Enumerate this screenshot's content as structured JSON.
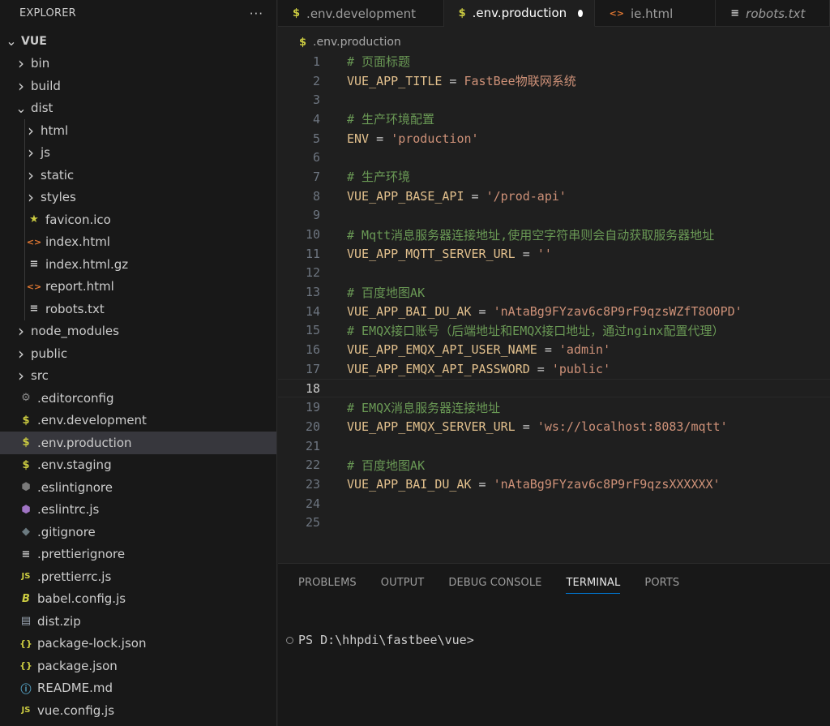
{
  "explorer": {
    "title": "EXPLORER",
    "more": "···",
    "items": [
      {
        "label": "VUE",
        "depth": 0,
        "kind": "root",
        "twisty": "down",
        "icon": ""
      },
      {
        "label": "bin",
        "depth": 1,
        "kind": "folder",
        "twisty": "right",
        "icon": ""
      },
      {
        "label": "build",
        "depth": 1,
        "kind": "folder",
        "twisty": "right",
        "icon": ""
      },
      {
        "label": "dist",
        "depth": 1,
        "kind": "folder",
        "twisty": "down",
        "icon": ""
      },
      {
        "label": "html",
        "depth": 2,
        "kind": "folder",
        "twisty": "right",
        "icon": ""
      },
      {
        "label": "js",
        "depth": 2,
        "kind": "folder",
        "twisty": "right",
        "icon": ""
      },
      {
        "label": "static",
        "depth": 2,
        "kind": "folder",
        "twisty": "right",
        "icon": ""
      },
      {
        "label": "styles",
        "depth": 2,
        "kind": "folder",
        "twisty": "right",
        "icon": ""
      },
      {
        "label": "favicon.ico",
        "depth": 2,
        "kind": "file",
        "icon": "star-icon"
      },
      {
        "label": "index.html",
        "depth": 2,
        "kind": "file",
        "icon": "html-icon"
      },
      {
        "label": "index.html.gz",
        "depth": 2,
        "kind": "file",
        "icon": "lines-icon"
      },
      {
        "label": "report.html",
        "depth": 2,
        "kind": "file",
        "icon": "html-icon"
      },
      {
        "label": "robots.txt",
        "depth": 2,
        "kind": "file",
        "icon": "lines-icon"
      },
      {
        "label": "node_modules",
        "depth": 1,
        "kind": "folder",
        "twisty": "right",
        "icon": ""
      },
      {
        "label": "public",
        "depth": 1,
        "kind": "folder",
        "twisty": "right",
        "icon": ""
      },
      {
        "label": "src",
        "depth": 1,
        "kind": "folder",
        "twisty": "right",
        "icon": ""
      },
      {
        "label": ".editorconfig",
        "depth": 1,
        "kind": "file",
        "icon": "gear-icon"
      },
      {
        "label": ".env.development",
        "depth": 1,
        "kind": "file",
        "icon": "dollar-icon"
      },
      {
        "label": ".env.production",
        "depth": 1,
        "kind": "file",
        "icon": "dollar-icon",
        "selected": true
      },
      {
        "label": ".env.staging",
        "depth": 1,
        "kind": "file",
        "icon": "dollar-icon"
      },
      {
        "label": ".eslintignore",
        "depth": 1,
        "kind": "file",
        "icon": "eslint-gray-icon"
      },
      {
        "label": ".eslintrc.js",
        "depth": 1,
        "kind": "file",
        "icon": "eslint-icon"
      },
      {
        "label": ".gitignore",
        "depth": 1,
        "kind": "file",
        "icon": "git-icon"
      },
      {
        "label": ".prettierignore",
        "depth": 1,
        "kind": "file",
        "icon": "lines-icon"
      },
      {
        "label": ".prettierrc.js",
        "depth": 1,
        "kind": "file",
        "icon": "js-icon"
      },
      {
        "label": "babel.config.js",
        "depth": 1,
        "kind": "file",
        "icon": "babel-icon"
      },
      {
        "label": "dist.zip",
        "depth": 1,
        "kind": "file",
        "icon": "zip-icon"
      },
      {
        "label": "package-lock.json",
        "depth": 1,
        "kind": "file",
        "icon": "json-icon"
      },
      {
        "label": "package.json",
        "depth": 1,
        "kind": "file",
        "icon": "json-icon"
      },
      {
        "label": "README.md",
        "depth": 1,
        "kind": "file",
        "icon": "info-icon"
      },
      {
        "label": "vue.config.js",
        "depth": 1,
        "kind": "file",
        "icon": "js-icon"
      }
    ]
  },
  "tabs": [
    {
      "label": ".env.development",
      "icon": "dollar-icon",
      "active": false,
      "italic": false,
      "dirty": false
    },
    {
      "label": ".env.production",
      "icon": "dollar-icon",
      "active": true,
      "italic": false,
      "dirty": true
    },
    {
      "label": "ie.html",
      "icon": "html-icon",
      "active": false,
      "italic": false,
      "dirty": false
    },
    {
      "label": "robots.txt",
      "icon": "lines-icon",
      "active": false,
      "italic": true,
      "dirty": false
    }
  ],
  "breadcrumb": {
    "icon": "dollar-icon",
    "label": ".env.production"
  },
  "editor": {
    "current_line": 18,
    "lines": [
      {
        "n": "1",
        "type": "comment",
        "text": "# 页面标题"
      },
      {
        "n": "2",
        "type": "kv",
        "key": "VUE_APP_TITLE",
        "op": " = ",
        "val": "FastBee物联网系统"
      },
      {
        "n": "3",
        "type": "blank"
      },
      {
        "n": "4",
        "type": "comment",
        "text": "# 生产环境配置"
      },
      {
        "n": "5",
        "type": "kv",
        "key": "ENV",
        "op": " = ",
        "val": "'production'"
      },
      {
        "n": "6",
        "type": "blank"
      },
      {
        "n": "7",
        "type": "comment",
        "text": "# 生产环境"
      },
      {
        "n": "8",
        "type": "kv",
        "key": "VUE_APP_BASE_API",
        "op": " = ",
        "val": "'/prod-api'"
      },
      {
        "n": "9",
        "type": "blank"
      },
      {
        "n": "10",
        "type": "comment",
        "text": "# Mqtt消息服务器连接地址,使用空字符串则会自动获取服务器地址"
      },
      {
        "n": "11",
        "type": "kv",
        "key": "VUE_APP_MQTT_SERVER_URL",
        "op": " = ",
        "val": "''"
      },
      {
        "n": "12",
        "type": "blank"
      },
      {
        "n": "13",
        "type": "comment",
        "text": "# 百度地图AK"
      },
      {
        "n": "14",
        "type": "kv",
        "key": "VUE_APP_BAI_DU_AK",
        "op": " = ",
        "val": "'nAtaBg9FYzav6c8P9rF9qzsWZfT8O0PD'"
      },
      {
        "n": "15",
        "type": "comment",
        "text": "# EMQX接口账号（后端地址和EMQX接口地址，通过nginx配置代理）"
      },
      {
        "n": "16",
        "type": "kv",
        "key": "VUE_APP_EMQX_API_USER_NAME",
        "op": " = ",
        "val": "'admin'"
      },
      {
        "n": "17",
        "type": "kv",
        "key": "VUE_APP_EMQX_API_PASSWORD",
        "op": " = ",
        "val": "'public'"
      },
      {
        "n": "18",
        "type": "blank"
      },
      {
        "n": "19",
        "type": "comment",
        "text": "# EMQX消息服务器连接地址"
      },
      {
        "n": "20",
        "type": "kv",
        "key": "VUE_APP_EMQX_SERVER_URL",
        "op": " = ",
        "val": "'ws://localhost:8083/mqtt'"
      },
      {
        "n": "21",
        "type": "blank"
      },
      {
        "n": "22",
        "type": "comment",
        "text": "# 百度地图AK"
      },
      {
        "n": "23",
        "type": "kv",
        "key": "VUE_APP_BAI_DU_AK",
        "op": " = ",
        "val": "'nAtaBg9FYzav6c8P9rF9qzsXXXXXX'"
      },
      {
        "n": "24",
        "type": "blank"
      },
      {
        "n": "25",
        "type": "blank"
      }
    ]
  },
  "panel": {
    "tabs": [
      {
        "label": "PROBLEMS",
        "active": false
      },
      {
        "label": "OUTPUT",
        "active": false
      },
      {
        "label": "DEBUG CONSOLE",
        "active": false
      },
      {
        "label": "TERMINAL",
        "active": true
      },
      {
        "label": "PORTS",
        "active": false
      }
    ],
    "terminal_prompt": "PS D:\\hhpdi\\fastbee\\vue>"
  },
  "colors": {
    "env": "#cbcb41",
    "html": "#e37933",
    "star": "#cbcb41",
    "js": "#cbcb41",
    "json": "#cbcb41",
    "info": "#519aba",
    "eslint": "#a074c4",
    "git": "#41535b",
    "gear": "#8b8b8b"
  }
}
